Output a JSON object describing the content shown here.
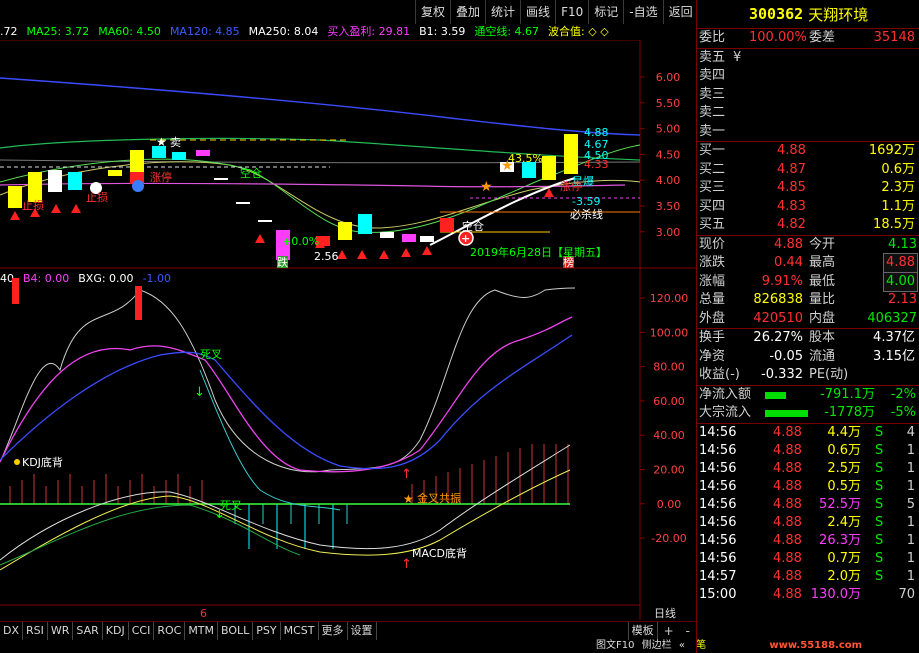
{
  "toolbar": {
    "buttons": [
      "复权",
      "叠加",
      "统计",
      "画线",
      "F10",
      "标记",
      "-自选",
      "返回"
    ]
  },
  "legend_main": [
    {
      "text": ".72",
      "color": "#ffffff"
    },
    {
      "text": "MA25: 3.72",
      "color": "#00ff00"
    },
    {
      "text": "MA60: 4.50",
      "color": "#00ff00"
    },
    {
      "text": "MA120: 4.85",
      "color": "#3a5cff"
    },
    {
      "text": "MA250: 8.04",
      "color": "#ffffff"
    },
    {
      "text": "买入盈利: 29.81",
      "color": "#ff3cff"
    },
    {
      "text": "B1: 3.59",
      "color": "#ffffff"
    },
    {
      "text": "通空线: 4.67",
      "color": "#00ff00"
    },
    {
      "text": "波合值: ◇ ◇",
      "color": "#ffff00"
    }
  ],
  "legend_sub": [
    {
      "text": "40",
      "color": "#ffffff"
    },
    {
      "text": "B4: 0.00",
      "color": "#ff3cff"
    },
    {
      "text": "BXG: 0.00",
      "color": "#ffffff"
    },
    {
      "text": "-1.00",
      "color": "#3a5cff"
    }
  ],
  "price_axis": [
    "6.00",
    "5.50",
    "5.00",
    "4.50",
    "4.00",
    "3.50",
    "3.00"
  ],
  "osc_axis": [
    "120.00",
    "100.00",
    "80.00",
    "60.00",
    "40.00",
    "20.00",
    "0.00",
    "-20.00"
  ],
  "annotations": {
    "right_levels": [
      "4.88",
      "4.67",
      "4.50",
      "4.33"
    ],
    "pct": "43.5%",
    "star_label": "星爆",
    "kill_line": "必杀线",
    "kill_value": "-3.59",
    "date_label": "2019年6月28日【星期五】",
    "low_price": "2.56",
    "pct_low": "+0.0%",
    "bang_label": "榜",
    "fall_label": "跌",
    "sell_label": "卖",
    "kdj_label": "KDJ底背",
    "macd_label": "MACD底背",
    "gold_label": "金叉共振",
    "death1": "死叉",
    "death2": "死叉",
    "open_pos": "空仓",
    "open_pos2": "空仓",
    "stop_loss": "止损",
    "stop2": "止损",
    "limit_up": "涨停",
    "limit_up2": "涨停",
    "stage_num": "6"
  },
  "tabs": [
    "DX",
    "RSI",
    "WR",
    "SAR",
    "KDJ",
    "CCI",
    "ROC",
    "MTM",
    "BOLL",
    "PSY",
    "MCST",
    "更多",
    "设置"
  ],
  "tabs_right": [
    "模板",
    "+",
    "-"
  ],
  "period": "日线",
  "bottom_strip": {
    "left": "图文F10",
    "mid": "侧边栏",
    "arrow": "«",
    "tab": "笔",
    "watermark": "www.55188.com"
  },
  "quote": {
    "code": "300362",
    "name": "天翔环境",
    "wei_bi": {
      "label": "委比",
      "value": "100.00%"
    },
    "wei_cha": {
      "label": "委差",
      "value": "35148"
    },
    "sells": [
      {
        "label": "卖五",
        "price": "¥",
        "vol": ""
      },
      {
        "label": "卖四",
        "price": "",
        "vol": ""
      },
      {
        "label": "卖三",
        "price": "",
        "vol": ""
      },
      {
        "label": "卖二",
        "price": "",
        "vol": ""
      },
      {
        "label": "卖一",
        "price": "",
        "vol": ""
      }
    ],
    "buys": [
      {
        "label": "买一",
        "price": "4.88",
        "vol": "1692万"
      },
      {
        "label": "买二",
        "price": "4.87",
        "vol": "0.6万"
      },
      {
        "label": "买三",
        "price": "4.85",
        "vol": "2.3万"
      },
      {
        "label": "买四",
        "price": "4.83",
        "vol": "1.1万"
      },
      {
        "label": "买五",
        "price": "4.82",
        "vol": "18.5万"
      }
    ],
    "stats": [
      {
        "l1": "现价",
        "v1": "4.88",
        "c1": "red",
        "l2": "今开",
        "v2": "4.13",
        "c2": "green",
        "box2": false
      },
      {
        "l1": "涨跌",
        "v1": "0.44",
        "c1": "red",
        "l2": "最高",
        "v2": "4.88",
        "c2": "red",
        "box2": true
      },
      {
        "l1": "涨幅",
        "v1": "9.91%",
        "c1": "red",
        "l2": "最低",
        "v2": "4.00",
        "c2": "green",
        "box2": true
      },
      {
        "l1": "总量",
        "v1": "826838",
        "c1": "yellow",
        "l2": "量比",
        "v2": "2.13",
        "c2": "red",
        "box2": false
      },
      {
        "l1": "外盘",
        "v1": "420510",
        "c1": "red",
        "l2": "内盘",
        "v2": "406327",
        "c2": "green",
        "box2": false
      }
    ],
    "fund": [
      {
        "l1": "换手",
        "v1": "26.27%",
        "l2": "股本",
        "v2": "4.37亿"
      },
      {
        "l1": "净资",
        "v1": "-0.05",
        "l2": "流通",
        "v2": "3.15亿"
      },
      {
        "l1": "收益(-)",
        "v1": "-0.332",
        "l2": "PE(动)",
        "v2": ""
      }
    ],
    "flows": [
      {
        "label": "净流入额",
        "value": "-791.1万",
        "pct": "-2%",
        "bar_frac": 0.3
      },
      {
        "label": "大宗流入",
        "value": "-1778万",
        "pct": "-5%",
        "bar_frac": 0.62
      }
    ],
    "ticks": [
      {
        "time": "14:56",
        "price": "4.88",
        "vol": "4.4万",
        "side": "S",
        "n": "4",
        "vc": "yellow"
      },
      {
        "time": "14:56",
        "price": "4.88",
        "vol": "0.6万",
        "side": "S",
        "n": "1",
        "vc": "yellow"
      },
      {
        "time": "14:56",
        "price": "4.88",
        "vol": "2.5万",
        "side": "S",
        "n": "1",
        "vc": "yellow"
      },
      {
        "time": "14:56",
        "price": "4.88",
        "vol": "0.5万",
        "side": "S",
        "n": "1",
        "vc": "yellow"
      },
      {
        "time": "14:56",
        "price": "4.88",
        "vol": "52.5万",
        "side": "S",
        "n": "5",
        "vc": "magenta"
      },
      {
        "time": "14:56",
        "price": "4.88",
        "vol": "2.4万",
        "side": "S",
        "n": "1",
        "vc": "yellow"
      },
      {
        "time": "14:56",
        "price": "4.88",
        "vol": "26.3万",
        "side": "S",
        "n": "1",
        "vc": "magenta"
      },
      {
        "time": "14:56",
        "price": "4.88",
        "vol": "0.7万",
        "side": "S",
        "n": "1",
        "vc": "yellow"
      },
      {
        "time": "14:57",
        "price": "4.88",
        "vol": "2.0万",
        "side": "S",
        "n": "1",
        "vc": "yellow"
      },
      {
        "time": "15:00",
        "price": "4.88",
        "vol": "130.0万",
        "side": "",
        "n": "70",
        "vc": "magenta"
      }
    ]
  }
}
